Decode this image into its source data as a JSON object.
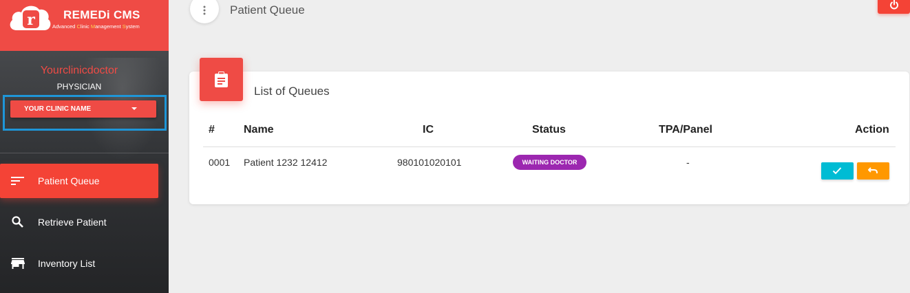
{
  "brand": {
    "title": "REMEDi CMS",
    "subtitle_parts": [
      "Advanced ",
      "C",
      "linic ",
      "M",
      "anagement ",
      "S",
      "ystem"
    ],
    "logo_letter": "r"
  },
  "user": {
    "name": "Yourclinicdoctor",
    "role": "PHYSICIAN",
    "clinic_select": "YOUR CLINIC NAME"
  },
  "nav": {
    "items": [
      {
        "label": "Patient Queue",
        "icon": "sort-icon",
        "active": true
      },
      {
        "label": "Retrieve Patient",
        "icon": "search-icon",
        "active": false
      },
      {
        "label": "Inventory List",
        "icon": "store-icon",
        "active": false
      }
    ]
  },
  "header": {
    "page_title": "Patient Queue"
  },
  "card": {
    "title": "List of Queues",
    "columns": [
      "#",
      "Name",
      "IC",
      "Status",
      "TPA/Panel",
      "Action"
    ],
    "rows": [
      {
        "no": "0001",
        "name": "Patient 1232 12412",
        "ic": "980101020101",
        "status": "WAITING DOCTOR",
        "tpa": "-"
      }
    ]
  },
  "colors": {
    "brand": "#ef4b45",
    "accent_blue": "#1e96d8",
    "status_purple": "#9c27b0",
    "confirm": "#00bcd4",
    "return": "#ff9800"
  }
}
